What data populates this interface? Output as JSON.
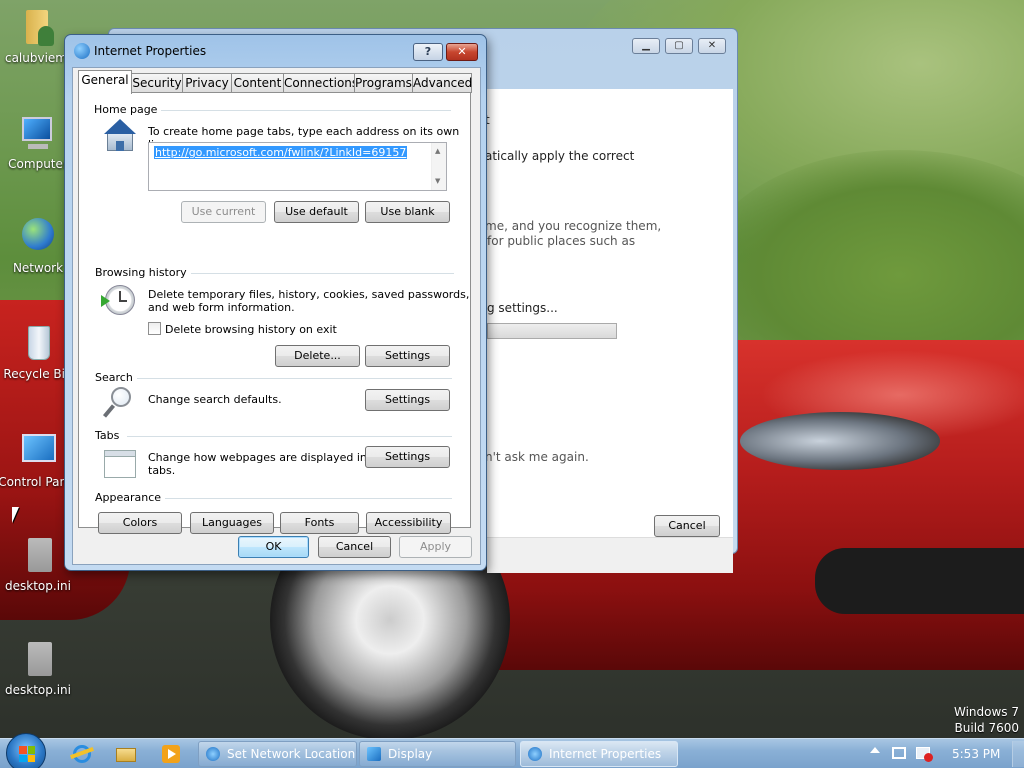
{
  "desktop": {
    "icons": [
      {
        "label": "calubviem",
        "icon": "user-folder-icon"
      },
      {
        "label": "Computer",
        "icon": "computer-icon"
      },
      {
        "label": "Network",
        "icon": "network-icon"
      },
      {
        "label": "Recycle Bin",
        "icon": "recycle-bin-icon"
      },
      {
        "label": "Control Panel",
        "icon": "control-panel-icon"
      },
      {
        "label": "desktop.ini",
        "icon": "settings-file-icon"
      },
      {
        "label": "desktop.ini",
        "icon": "settings-file-icon"
      }
    ],
    "watermark": {
      "line1": "Windows 7",
      "line2": "Build 7600"
    }
  },
  "background_window": {
    "text_fragments": [
      "t",
      "atically apply the correct",
      "me, and you recognize them,",
      "for public places such as",
      "g settings...",
      "n't ask me again."
    ],
    "cancel_label": "Cancel"
  },
  "dialog": {
    "title": "Internet Properties",
    "help_glyph": "?",
    "close_glyph": "✕",
    "tabs": [
      "General",
      "Security",
      "Privacy",
      "Content",
      "Connections",
      "Programs",
      "Advanced"
    ],
    "active_tab": "General",
    "home_page": {
      "group_label": "Home page",
      "description": "To create home page tabs, type each address on its own line.",
      "url": "http://go.microsoft.com/fwlink/?LinkId=69157",
      "use_current": "Use current",
      "use_default": "Use default",
      "use_blank": "Use blank"
    },
    "browsing_history": {
      "group_label": "Browsing history",
      "description_line1": "Delete temporary files, history, cookies, saved passwords,",
      "description_line2": "and web form information.",
      "checkbox_label": "Delete browsing history on exit",
      "checkbox_checked": false,
      "delete_label": "Delete...",
      "settings_label": "Settings"
    },
    "search": {
      "group_label": "Search",
      "description": "Change search defaults.",
      "settings_label": "Settings"
    },
    "tabs_section": {
      "group_label": "Tabs",
      "description_line1": "Change how webpages are displayed in",
      "description_line2": "tabs.",
      "settings_label": "Settings"
    },
    "appearance": {
      "group_label": "Appearance",
      "colors": "Colors",
      "languages": "Languages",
      "fonts": "Fonts",
      "accessibility": "Accessibility"
    },
    "footer": {
      "ok": "OK",
      "cancel": "Cancel",
      "apply": "Apply"
    }
  },
  "taskbar": {
    "items": [
      {
        "label": "Set Network Location",
        "icon": "network-location-icon",
        "active": false
      },
      {
        "label": "Display",
        "icon": "display-icon",
        "active": false
      },
      {
        "label": "Internet Properties",
        "icon": "internet-options-icon",
        "active": true
      }
    ],
    "clock": "5:53 PM"
  }
}
